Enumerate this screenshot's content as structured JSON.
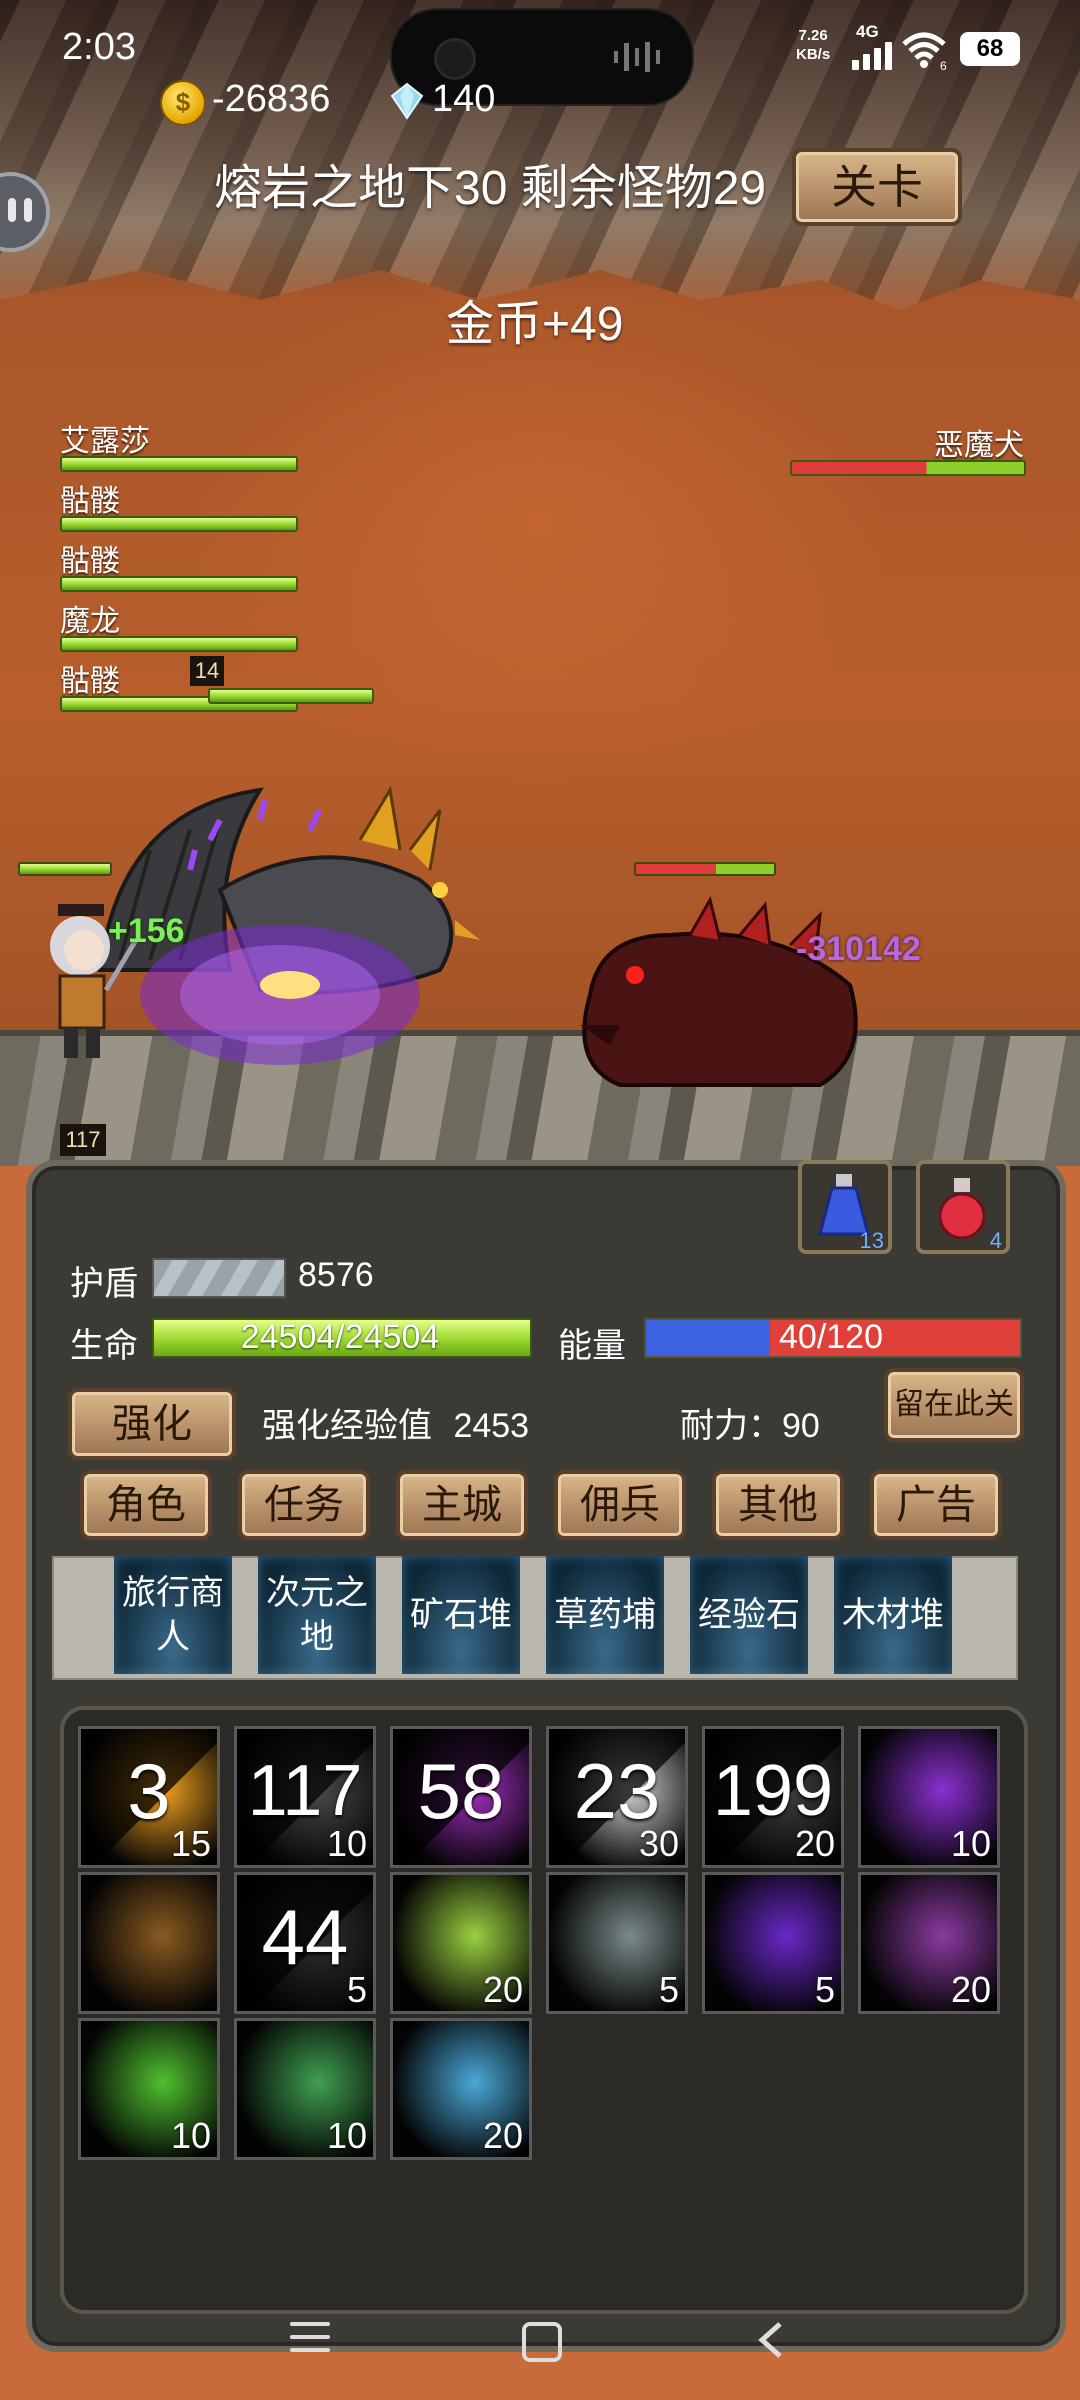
{
  "status_bar": {
    "time": "2:03",
    "net_speed": "7.26",
    "net_speed_unit": "KB/s",
    "net_type": "4G",
    "wifi_badge": "6",
    "battery": "68",
    "icons": [
      "signal-icon",
      "wifi-icon",
      "battery-icon"
    ]
  },
  "currency": {
    "gold": "-26836",
    "gems": "140",
    "gold_icon": "gold-coin-icon",
    "gem_icon": "diamond-icon"
  },
  "stage": {
    "title": "熔岩之地下30 剩余怪物29",
    "button": "关卡"
  },
  "popup_gold": "金币+49",
  "party": [
    {
      "name": "艾露莎",
      "hp_fraction": 1.0
    },
    {
      "name": "骷髅",
      "hp_fraction": 1.0
    },
    {
      "name": "骷髅",
      "hp_fraction": 1.0
    },
    {
      "name": "魔龙",
      "hp_fraction": 1.0
    },
    {
      "name": "骷髅",
      "hp_fraction": 1.0
    }
  ],
  "party_level_badge": "14",
  "enemy": {
    "name": "恶魔犬",
    "hp_fraction": 0.42
  },
  "battle": {
    "heal": "+156",
    "damage": "-310142",
    "hero_level": "117"
  },
  "potions": {
    "blue_count": "13",
    "red_count": "4"
  },
  "stats": {
    "shield_label": "护盾",
    "shield_value": "8576",
    "life_label": "生命",
    "life_value": "24504/24504",
    "energy_label": "能量",
    "energy_value": "40/120",
    "energy_fraction": 0.333
  },
  "enhance": {
    "button": "强化",
    "exp_label": "强化经验值",
    "exp_value": "2453",
    "stamina_label": "耐力：",
    "stamina_value": "90",
    "stay_button": "留在此关"
  },
  "menu": [
    "角色",
    "任务",
    "主城",
    "佣兵",
    "其他",
    "广告"
  ],
  "shops": [
    "旅行商人",
    "次元之地",
    "矿石堆",
    "草药埔",
    "经验石",
    "木材堆"
  ],
  "skills": [
    {
      "cooldown": "3",
      "level": "15",
      "icon": "fire-orb-skill-icon",
      "color": "#f0a020"
    },
    {
      "cooldown": "117",
      "level": "10",
      "icon": "dark-blade-skill-icon",
      "color": "#4a4a4a"
    },
    {
      "cooldown": "58",
      "level": "",
      "icon": "purple-blade-skill-icon",
      "color": "#a030c0"
    },
    {
      "cooldown": "23",
      "level": "30",
      "icon": "white-slash-skill-icon",
      "color": "#cfcfcf"
    },
    {
      "cooldown": "199",
      "level": "20",
      "icon": "shadow-skill-icon",
      "color": "#404040"
    },
    {
      "cooldown": "",
      "level": "10",
      "icon": "void-skill-icon",
      "color": "#8a30d0"
    },
    {
      "cooldown": "",
      "level": "",
      "icon": "rune-skill-icon",
      "color": "#8a5a20"
    },
    {
      "cooldown": "44",
      "level": "5",
      "icon": "dark-skill-icon",
      "color": "#303030"
    },
    {
      "cooldown": "",
      "level": "20",
      "icon": "lightning-skill-icon",
      "color": "#9ad040"
    },
    {
      "cooldown": "",
      "level": "5",
      "icon": "ghost-skill-icon",
      "color": "#7a8a8a"
    },
    {
      "cooldown": "",
      "level": "5",
      "icon": "demon-skill-icon",
      "color": "#6a28c8"
    },
    {
      "cooldown": "",
      "level": "20",
      "icon": "dragon-skill-icon",
      "color": "#8a3aa0"
    },
    {
      "cooldown": "",
      "level": "10",
      "icon": "heal-cross-skill-icon",
      "color": "#50c030"
    },
    {
      "cooldown": "",
      "level": "10",
      "icon": "wind-skill-icon",
      "color": "#40a050"
    },
    {
      "cooldown": "",
      "level": "20",
      "icon": "ice-skill-icon",
      "color": "#4aa8d8"
    }
  ],
  "nav": [
    "menu-icon",
    "home-icon",
    "back-icon"
  ]
}
